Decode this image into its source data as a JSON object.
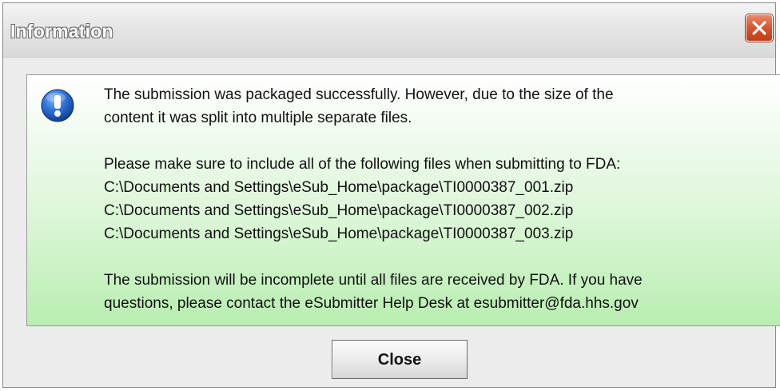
{
  "window": {
    "title": "Information"
  },
  "dialog": {
    "icon": "info-icon",
    "lines": {
      "l1": "The submission was packaged successfully. However, due to the size of the",
      "l2": "content it was split into multiple separate files.",
      "l3": "Please make sure to include all of the following files when submitting to FDA:",
      "l4": "C:\\Documents and Settings\\eSub_Home\\package\\TI0000387_001.zip",
      "l5": "C:\\Documents and Settings\\eSub_Home\\package\\TI0000387_002.zip",
      "l6": "C:\\Documents and Settings\\eSub_Home\\package\\TI0000387_003.zip",
      "l7": "The submission will be incomplete until all files are received by FDA. If you have",
      "l8": "questions, please contact the eSubmitter Help Desk at esubmitter@fda.hhs.gov"
    }
  },
  "buttons": {
    "close_label": "Close",
    "close_icon": "close-icon"
  },
  "colors": {
    "content_gradient_top": "#ffffff",
    "content_gradient_bottom": "#b8eeb0",
    "close_x": "#d8542c",
    "info_icon": "#1e5fc4"
  }
}
